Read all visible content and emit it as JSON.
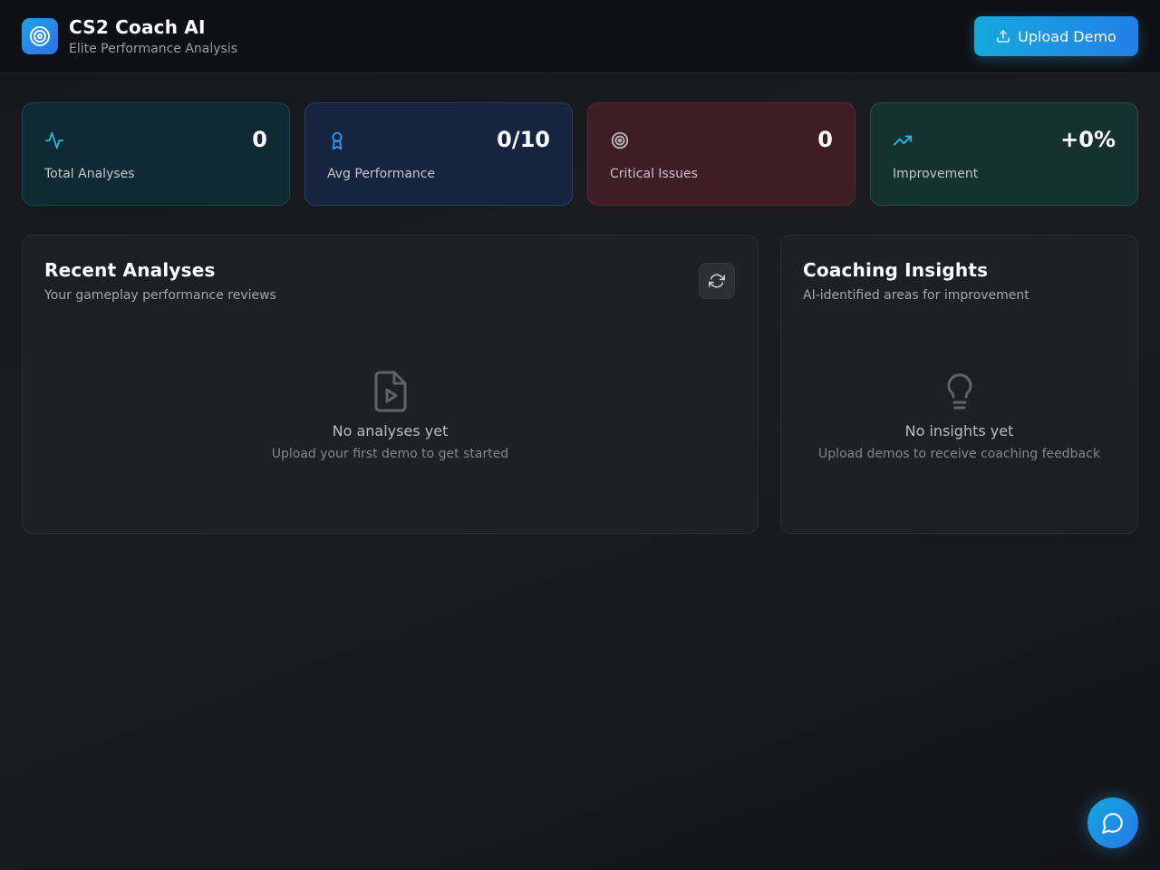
{
  "header": {
    "title": "CS2 Coach AI",
    "subtitle": "Elite Performance Analysis",
    "logo_icon": "target-icon",
    "upload_label": "Upload Demo",
    "upload_icon": "upload-icon"
  },
  "stats": [
    {
      "icon": "activity-icon",
      "value": "0",
      "label": "Total Analyses",
      "accent": "#22b8e6"
    },
    {
      "icon": "award-icon",
      "value": "0/10",
      "label": "Avg Performance",
      "accent": "#2f9df0"
    },
    {
      "icon": "target-icon",
      "value": "0",
      "label": "Critical Issues",
      "accent": "#b9b9bd"
    },
    {
      "icon": "trending-up-icon",
      "value": "+0%",
      "label": "Improvement",
      "accent": "#22b8e6"
    }
  ],
  "recent": {
    "title": "Recent Analyses",
    "subtitle": "Your gameplay performance reviews",
    "refresh_icon": "refresh-icon",
    "empty_icon": "file-video-icon",
    "empty_title": "No analyses yet",
    "empty_sub": "Upload your first demo to get started"
  },
  "insights": {
    "title": "Coaching Insights",
    "subtitle": "AI-identified areas for improvement",
    "empty_icon": "lightbulb-icon",
    "empty_title": "No insights yet",
    "empty_sub": "Upload demos to receive coaching feedback"
  },
  "chat": {
    "icon": "chat-icon"
  },
  "colors": {
    "accent": "#1ea4e6",
    "accent_dark": "#2280e6",
    "background": "#16181c"
  }
}
